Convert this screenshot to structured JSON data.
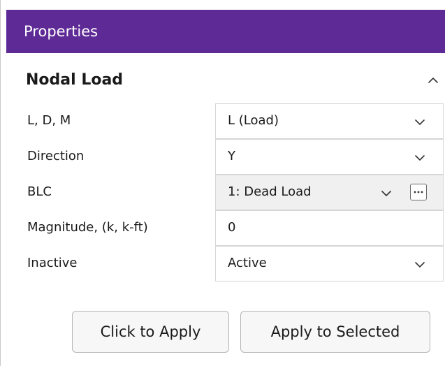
{
  "window": {
    "title": "Properties"
  },
  "section": {
    "title": "Nodal Load",
    "collapse_icon": "chevron-up-icon"
  },
  "rows": [
    {
      "label": "L, D, M",
      "value": "L (Load)",
      "control": "dropdown"
    },
    {
      "label": "Direction",
      "value": "Y",
      "control": "dropdown"
    },
    {
      "label": "BLC",
      "value": "1: Dead Load",
      "control": "dropdown-with-ellipsis",
      "ellipsis": "···"
    },
    {
      "label": "Magnitude, (k, k-ft)",
      "value": "0",
      "control": "text-input"
    },
    {
      "label": "Inactive",
      "value": "Active",
      "control": "dropdown"
    }
  ],
  "buttons": {
    "click_to_apply": "Click to Apply",
    "apply_to_selected": "Apply to Selected"
  },
  "colors": {
    "titlebar": "#5e2a96",
    "titlebar_text": "#ffffff",
    "field_border": "#d6d6d6",
    "shaded_field": "#f0f0f0"
  }
}
